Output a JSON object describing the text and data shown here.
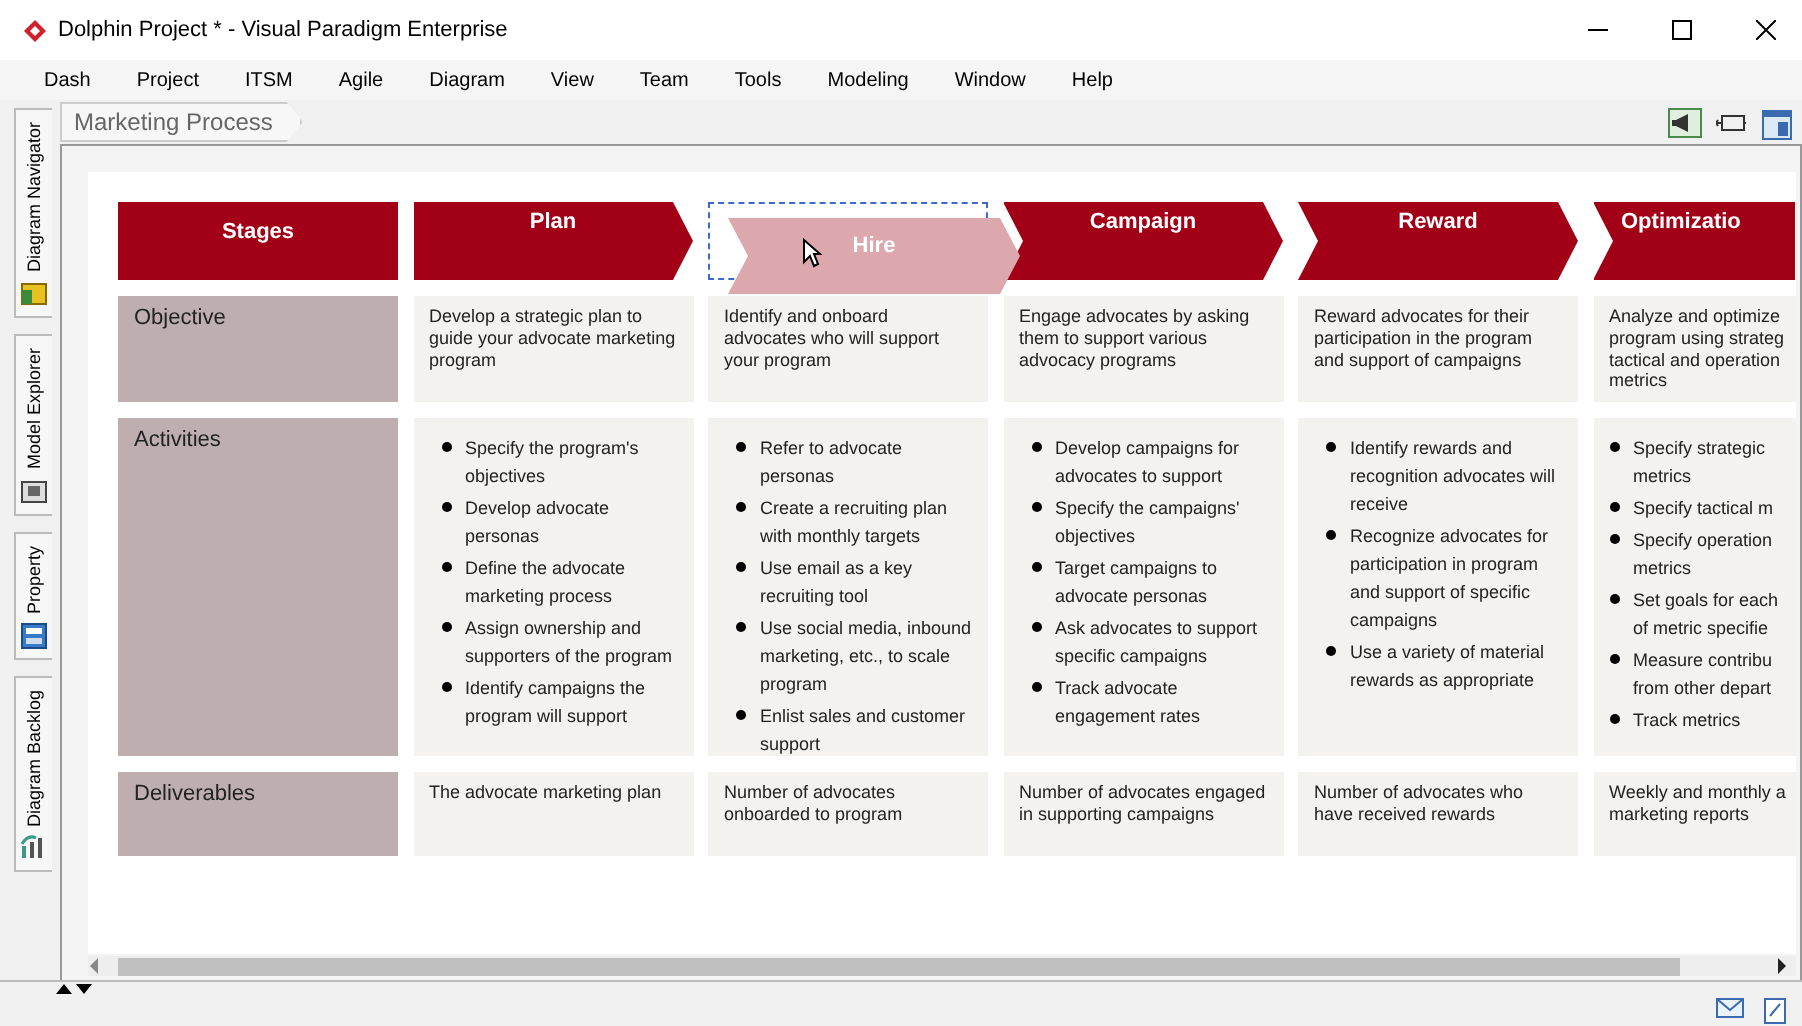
{
  "window": {
    "title": "Dolphin Project * - Visual Paradigm Enterprise"
  },
  "menu": [
    "Dash",
    "Project",
    "ITSM",
    "Agile",
    "Diagram",
    "View",
    "Team",
    "Tools",
    "Modeling",
    "Window",
    "Help"
  ],
  "side_tabs": [
    {
      "label": "Diagram Navigator",
      "kind": "navigator"
    },
    {
      "label": "Model Explorer",
      "kind": "explorer"
    },
    {
      "label": "Property",
      "kind": "property"
    },
    {
      "label": "Diagram Backlog",
      "kind": "backlog"
    }
  ],
  "breadcrumb": "Marketing Process",
  "diagram": {
    "stages_label": "Stages",
    "row_labels": [
      "Objective",
      "Activities",
      "Deliverables"
    ],
    "columns": [
      {
        "stage": "Plan",
        "kind": "first",
        "objective": "Develop a strategic plan to guide your advocate marketing program",
        "activities": [
          "Specify the program's objectives",
          "Develop advocate personas",
          "Define the advocate marketing process",
          "Assign ownership and supporters of the program",
          "Identify campaigns the program will support"
        ],
        "deliverables": "The advocate marketing plan"
      },
      {
        "stage": "Hire",
        "kind": "dragged",
        "objective": "Identify and onboard advocates who will support your program",
        "activities": [
          "Refer to advocate personas",
          "Create a recruiting plan with monthly targets",
          "Use email as a key recruiting tool",
          "Use social media, inbound marketing, etc., to scale program",
          "Enlist sales and customer support"
        ],
        "deliverables": "Number of advocates onboarded to program"
      },
      {
        "stage": "Campaign",
        "kind": "middle",
        "objective": "Engage advocates by asking them to support various advocacy programs",
        "activities": [
          "Develop campaigns for advocates to support",
          "Specify the campaigns' objectives",
          "Target campaigns to advocate personas",
          "Ask advocates to support specific campaigns",
          "Track advocate engagement rates"
        ],
        "deliverables": "Number of advocates engaged in supporting campaigns"
      },
      {
        "stage": "Reward",
        "kind": "middle",
        "objective": "Reward advocates for their participation in the program and support of campaigns",
        "activities": [
          "Identify rewards and recognition advocates will receive",
          "Recognize advocates for participation in program and support of specific campaigns",
          "Use a variety of material rewards as appropriate"
        ],
        "deliverables": "Number of advocates who have received rewards"
      },
      {
        "stage": "Optimizatio",
        "kind": "edge",
        "objective": "Analyze and optimize\nprogram using strateg\ntactical and operation\nmetrics",
        "activities": [
          "Specify strategic\nmetrics",
          "Specify tactical m",
          "Specify operation\nmetrics",
          "Set goals for each\nof metric specifie",
          "Measure contribu\nfrom other depart",
          "Track metrics"
        ],
        "deliverables": "Weekly and monthly a\nmarketing reports"
      }
    ]
  }
}
